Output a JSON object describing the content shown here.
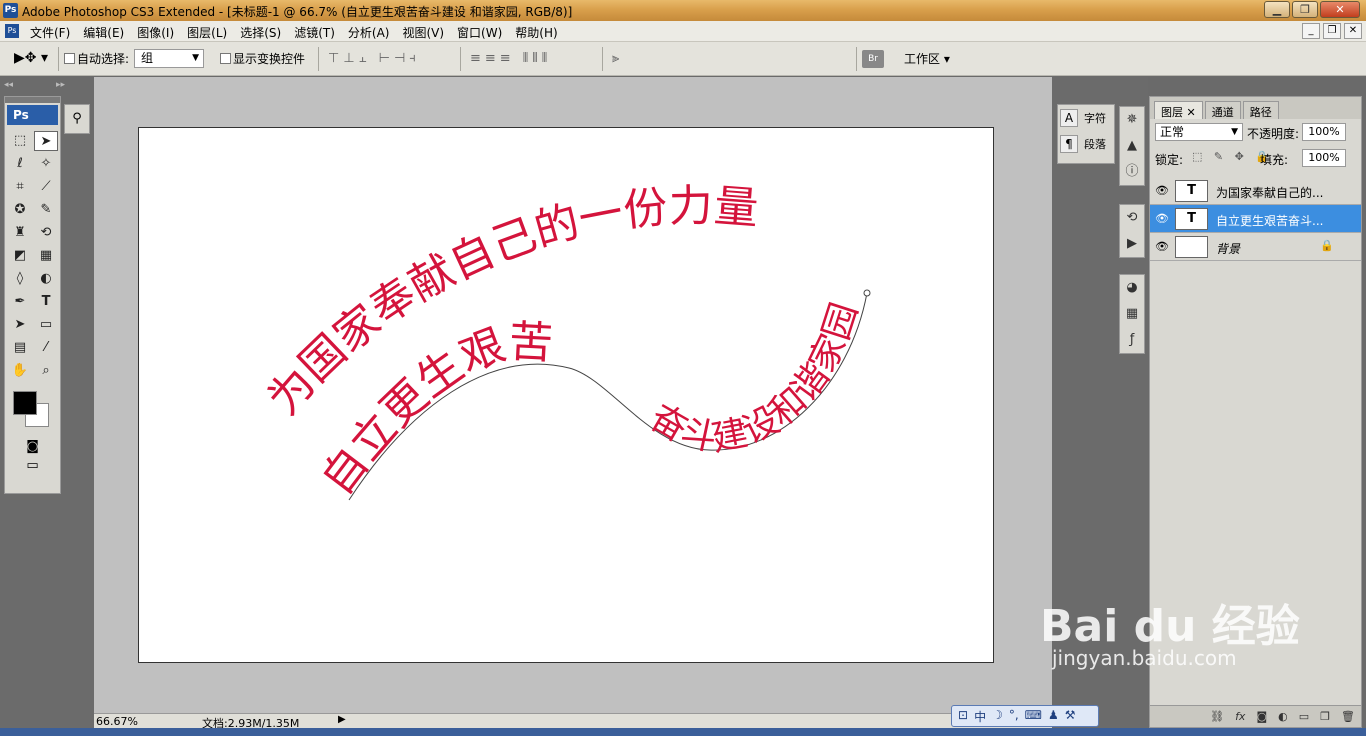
{
  "window": {
    "title": "Adobe Photoshop CS3 Extended - [未标题-1 @ 66.7% (自立更生艰苦奋斗建设 和谐家园, RGB/8)]",
    "app_icon": "Ps"
  },
  "menu": {
    "items": [
      "文件(F)",
      "编辑(E)",
      "图像(I)",
      "图层(L)",
      "选择(S)",
      "滤镜(T)",
      "分析(A)",
      "视图(V)",
      "窗口(W)",
      "帮助(H)"
    ]
  },
  "options": {
    "auto_select_label": "自动选择:",
    "auto_select_value": "组",
    "show_transform_label": "显示变换控件",
    "workspace_label": "工作区",
    "bridge_label": "Br"
  },
  "toolbox": {
    "logo": "Ps"
  },
  "canvas_text": {
    "top_arc": "为国家奉献自己的一份力量",
    "wave_part1": "自立更生艰苦",
    "wave_part2": "奋斗建设和谐家园",
    "text_color": "#d4143c"
  },
  "status": {
    "zoom": "66.67%",
    "doc": "文档:2.93M/1.35M"
  },
  "char_panel": {
    "char_label": "字符",
    "para_label": "段落"
  },
  "layers_panel": {
    "tabs": [
      "图层",
      "通道",
      "路径"
    ],
    "blend_mode": "正常",
    "opacity_label": "不透明度:",
    "opacity_value": "100%",
    "lock_label": "锁定:",
    "fill_label": "填充:",
    "fill_value": "100%",
    "layers": [
      {
        "name": "为国家奉献自己的...",
        "type": "T"
      },
      {
        "name": "自立更生艰苦奋斗...",
        "type": "T"
      },
      {
        "name": "背景",
        "type": ""
      }
    ],
    "bottom_icons": [
      "link",
      "fx",
      "mask",
      "adjust",
      "group",
      "new",
      "trash"
    ]
  },
  "watermark": {
    "logo": "Bai du 经验",
    "url": "jingyan.baidu.com"
  },
  "ime": {
    "mode": "中"
  }
}
